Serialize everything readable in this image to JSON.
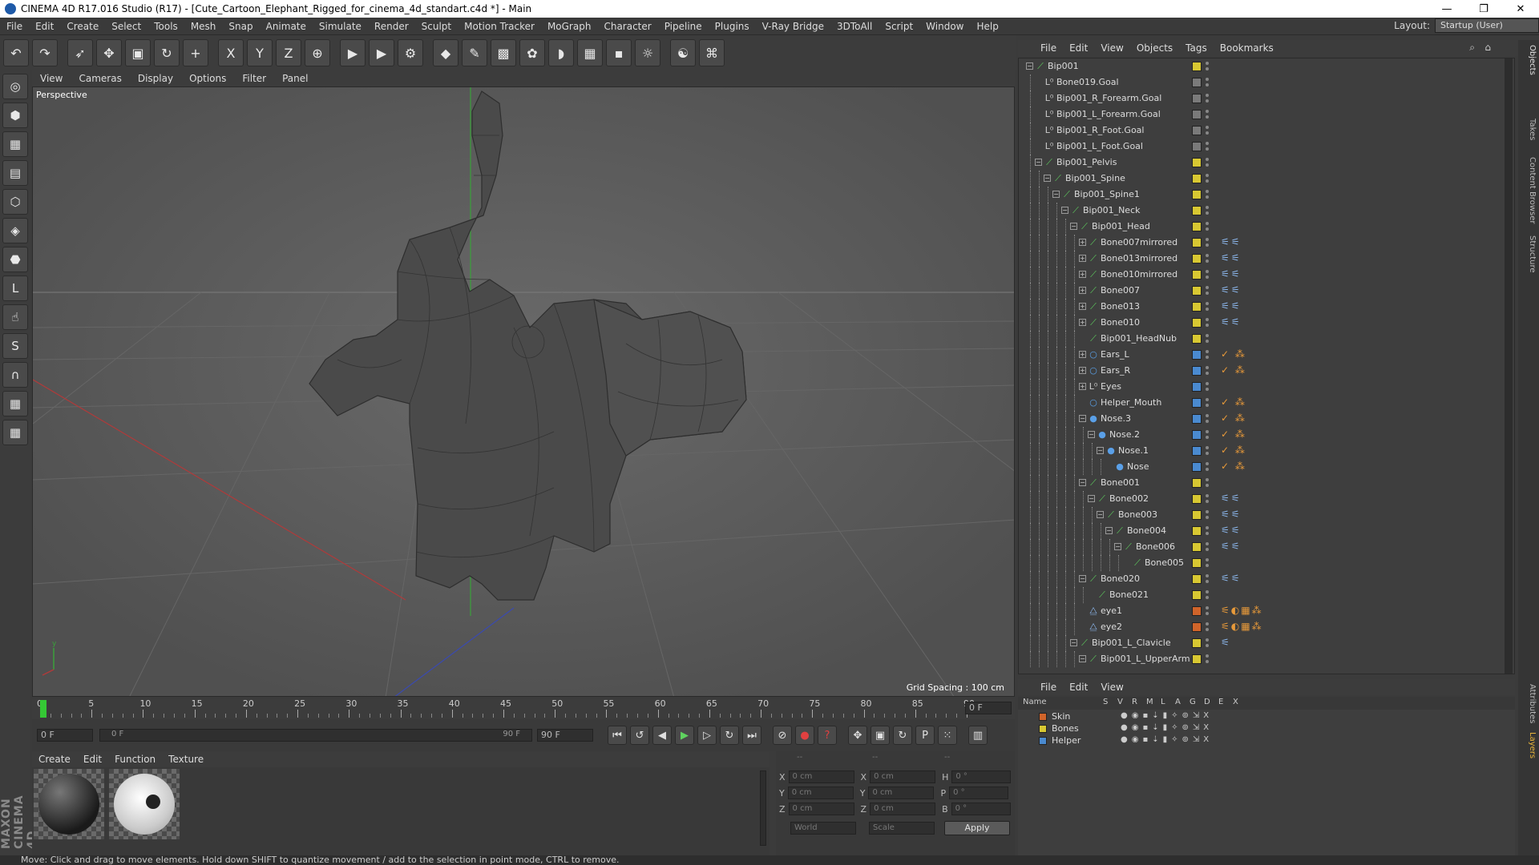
{
  "window": {
    "title": "CINEMA 4D R17.016 Studio (R17) - [Cute_Cartoon_Elephant_Rigged_for_cinema_4d_standart.c4d *] - Main",
    "controls": [
      "—",
      "❐",
      "✕"
    ]
  },
  "menubar": {
    "items": [
      "File",
      "Edit",
      "Create",
      "Select",
      "Tools",
      "Mesh",
      "Snap",
      "Animate",
      "Simulate",
      "Render",
      "Sculpt",
      "Motion Tracker",
      "MoGraph",
      "Character",
      "Pipeline",
      "Plugins",
      "V-Ray Bridge",
      "3DToAll",
      "Script",
      "Window",
      "Help"
    ],
    "layout_label": "Layout:",
    "layout_value": "Startup (User)"
  },
  "toolbar": {
    "icons": [
      "undo-icon",
      "redo-icon",
      "select-icon",
      "move-icon",
      "scale-icon",
      "rotate-icon",
      "add-icon",
      "x-axis-icon",
      "y-axis-icon",
      "z-axis-icon",
      "world-coord-icon",
      "render-view-icon",
      "render-picture-icon",
      "render-settings-icon",
      "cube-icon",
      "pen-icon",
      "subdivision-icon",
      "cloner-icon",
      "deformer-icon",
      "floor-icon",
      "camera-icon",
      "light-icon",
      "script-icon",
      "python-icon"
    ],
    "glyphs": [
      "↶",
      "↷",
      "➶",
      "✥",
      "▣",
      "↻",
      "+",
      "X",
      "Y",
      "Z",
      "⊕",
      "▶",
      "▶",
      "⚙",
      "◆",
      "✎",
      "▩",
      "✿",
      "◗",
      "▦",
      "▪",
      "☼",
      "☯",
      "⌘"
    ]
  },
  "lefttools": {
    "icons": [
      "make-editable-icon",
      "model-mode-icon",
      "texture-mode-icon",
      "workplane-icon",
      "points-mode-icon",
      "edges-mode-icon",
      "polygons-mode-icon",
      "axis-icon",
      "tweak-icon",
      "solo-icon",
      "magnet-icon",
      "snap-icon",
      "lock-icon"
    ],
    "glyphs": [
      "◎",
      "⬢",
      "▦",
      "▤",
      "⬡",
      "◈",
      "⬣",
      "L",
      "☝",
      "S",
      "∩",
      "▦",
      "▦"
    ],
    "logo": "MAXON CINEMA 4D"
  },
  "viewport": {
    "menu": [
      "View",
      "Cameras",
      "Display",
      "Options",
      "Filter",
      "Panel"
    ],
    "camera_label": "Perspective",
    "grid_spacing": "Grid Spacing : 100 cm"
  },
  "timeline": {
    "ticks": [
      "0",
      "5",
      "10",
      "15",
      "20",
      "25",
      "30",
      "35",
      "40",
      "45",
      "50",
      "55",
      "60",
      "65",
      "70",
      "75",
      "80",
      "85",
      "90"
    ],
    "current_frame": "0 F",
    "start_field": "0 F",
    "range_start": "0 F",
    "range_end": "90 F",
    "end_field": "90 F"
  },
  "playback": {
    "glyphs": [
      "⏮",
      "↺",
      "◀",
      "▶",
      "▷",
      "↻",
      "⏭",
      "⊘",
      "●",
      "?",
      "✥",
      "▣",
      "↻",
      "P",
      "⁙",
      "▥"
    ]
  },
  "materials": {
    "menu": [
      "Create",
      "Edit",
      "Function",
      "Texture"
    ],
    "items": [
      {
        "name": "",
        "color": "#3c3c3c"
      },
      {
        "name": "",
        "color": "#eaeaea"
      }
    ]
  },
  "coordinates": {
    "headers": [
      "--",
      "--",
      "--"
    ],
    "rows": [
      {
        "a": "X",
        "v1": "0 cm",
        "b": "X",
        "v2": "0 cm",
        "c": "H",
        "v3": "0 °"
      },
      {
        "a": "Y",
        "v1": "0 cm",
        "b": "Y",
        "v2": "0 cm",
        "c": "P",
        "v3": "0 °"
      },
      {
        "a": "Z",
        "v1": "0 cm",
        "b": "Z",
        "v2": "0 cm",
        "c": "B",
        "v3": "0 °"
      }
    ],
    "mode1": "World",
    "mode2": "Scale",
    "apply": "Apply"
  },
  "status": "Move: Click and drag to move elements. Hold down SHIFT to quantize movement / add to the selection in point mode, CTRL to remove.",
  "objects": {
    "menu": [
      "File",
      "Edit",
      "View",
      "Objects",
      "Tags",
      "Bookmarks"
    ],
    "items": [
      {
        "name": "Bip001",
        "depth": 0,
        "icon": "bone",
        "color": "#d8c832",
        "exp": "−",
        "tags": ""
      },
      {
        "name": "Bone019.Goal",
        "depth": 1,
        "icon": "null",
        "color": "#7a7a7a",
        "exp": "",
        "tags": ""
      },
      {
        "name": "Bip001_R_Forearm.Goal",
        "depth": 1,
        "icon": "null",
        "color": "#7a7a7a",
        "exp": "",
        "tags": ""
      },
      {
        "name": "Bip001_L_Forearm.Goal",
        "depth": 1,
        "icon": "null",
        "color": "#7a7a7a",
        "exp": "",
        "tags": ""
      },
      {
        "name": "Bip001_R_Foot.Goal",
        "depth": 1,
        "icon": "null",
        "color": "#7a7a7a",
        "exp": "",
        "tags": ""
      },
      {
        "name": "Bip001_L_Foot.Goal",
        "depth": 1,
        "icon": "null",
        "color": "#7a7a7a",
        "exp": "",
        "tags": ""
      },
      {
        "name": "Bip001_Pelvis",
        "depth": 1,
        "icon": "bone",
        "color": "#d8c832",
        "exp": "−",
        "tags": ""
      },
      {
        "name": "Bip001_Spine",
        "depth": 2,
        "icon": "bone",
        "color": "#d8c832",
        "exp": "−",
        "tags": ""
      },
      {
        "name": "Bip001_Spine1",
        "depth": 3,
        "icon": "bone",
        "color": "#d8c832",
        "exp": "−",
        "tags": ""
      },
      {
        "name": "Bip001_Neck",
        "depth": 4,
        "icon": "bone",
        "color": "#d8c832",
        "exp": "−",
        "tags": ""
      },
      {
        "name": "Bip001_Head",
        "depth": 5,
        "icon": "bone",
        "color": "#d8c832",
        "exp": "−",
        "tags": ""
      },
      {
        "name": "Bone007mirrored",
        "depth": 6,
        "icon": "bone",
        "color": "#d8c832",
        "exp": "+",
        "tags": "⚟⚟"
      },
      {
        "name": "Bone013mirrored",
        "depth": 6,
        "icon": "bone",
        "color": "#d8c832",
        "exp": "+",
        "tags": "⚟⚟"
      },
      {
        "name": "Bone010mirrored",
        "depth": 6,
        "icon": "bone",
        "color": "#d8c832",
        "exp": "+",
        "tags": "⚟⚟"
      },
      {
        "name": "Bone007",
        "depth": 6,
        "icon": "bone",
        "color": "#d8c832",
        "exp": "+",
        "tags": "⚟⚟"
      },
      {
        "name": "Bone013",
        "depth": 6,
        "icon": "bone",
        "color": "#d8c832",
        "exp": "+",
        "tags": "⚟⚟"
      },
      {
        "name": "Bone010",
        "depth": 6,
        "icon": "bone",
        "color": "#d8c832",
        "exp": "+",
        "tags": "⚟⚟"
      },
      {
        "name": "Bip001_HeadNub",
        "depth": 6,
        "icon": "bone",
        "color": "#d8c832",
        "exp": "",
        "tags": ""
      },
      {
        "name": "Ears_L",
        "depth": 6,
        "icon": "mesh",
        "color": "#4a8ad0",
        "exp": "+",
        "tags": "✓ ⁂"
      },
      {
        "name": "Ears_R",
        "depth": 6,
        "icon": "mesh",
        "color": "#4a8ad0",
        "exp": "+",
        "tags": "✓ ⁂"
      },
      {
        "name": "Eyes",
        "depth": 6,
        "icon": "null",
        "color": "#4a8ad0",
        "exp": "+",
        "tags": ""
      },
      {
        "name": "Helper_Mouth",
        "depth": 6,
        "icon": "mesh",
        "color": "#4a8ad0",
        "exp": "",
        "tags": "✓ ⁂"
      },
      {
        "name": "Nose.3",
        "depth": 6,
        "icon": "sphere",
        "color": "#4a8ad0",
        "exp": "−",
        "tags": "✓ ⁂"
      },
      {
        "name": "Nose.2",
        "depth": 7,
        "icon": "sphere",
        "color": "#4a8ad0",
        "exp": "−",
        "tags": "✓ ⁂"
      },
      {
        "name": "Nose.1",
        "depth": 8,
        "icon": "sphere",
        "color": "#4a8ad0",
        "exp": "−",
        "tags": "✓ ⁂"
      },
      {
        "name": "Nose",
        "depth": 9,
        "icon": "sphere",
        "color": "#4a8ad0",
        "exp": "",
        "tags": "✓ ⁂"
      },
      {
        "name": "Bone001",
        "depth": 6,
        "icon": "bone",
        "color": "#d8c832",
        "exp": "−",
        "tags": ""
      },
      {
        "name": "Bone002",
        "depth": 7,
        "icon": "bone",
        "color": "#d8c832",
        "exp": "−",
        "tags": "⚟⚟"
      },
      {
        "name": "Bone003",
        "depth": 8,
        "icon": "bone",
        "color": "#d8c832",
        "exp": "−",
        "tags": "⚟⚟"
      },
      {
        "name": "Bone004",
        "depth": 9,
        "icon": "bone",
        "color": "#d8c832",
        "exp": "−",
        "tags": "⚟⚟"
      },
      {
        "name": "Bone006",
        "depth": 10,
        "icon": "bone",
        "color": "#d8c832",
        "exp": "−",
        "tags": "⚟⚟"
      },
      {
        "name": "Bone005",
        "depth": 11,
        "icon": "bone",
        "color": "#d8c832",
        "exp": "",
        "tags": ""
      },
      {
        "name": "Bone020",
        "depth": 6,
        "icon": "bone",
        "color": "#d8c832",
        "exp": "−",
        "tags": "⚟⚟"
      },
      {
        "name": "Bone021",
        "depth": 7,
        "icon": "bone",
        "color": "#d8c832",
        "exp": "",
        "tags": ""
      },
      {
        "name": "eye1",
        "depth": 6,
        "icon": "joint",
        "color": "#d0642a",
        "exp": "",
        "tags": "⚟◐▦⁂"
      },
      {
        "name": "eye2",
        "depth": 6,
        "icon": "joint",
        "color": "#d0642a",
        "exp": "",
        "tags": "⚟◐▦⁂"
      },
      {
        "name": "Bip001_L_Clavicle",
        "depth": 5,
        "icon": "bone",
        "color": "#d8c832",
        "exp": "−",
        "tags": "⚟"
      },
      {
        "name": "Bip001_L_UpperArm",
        "depth": 6,
        "icon": "bone",
        "color": "#d8c832",
        "exp": "−",
        "tags": ""
      }
    ]
  },
  "layers": {
    "menu": [
      "File",
      "Edit",
      "View"
    ],
    "headers": [
      "Name",
      "S",
      "V",
      "R",
      "M",
      "L",
      "A",
      "G",
      "D",
      "E",
      "X"
    ],
    "items": [
      {
        "name": "Skin",
        "color": "#d0642a"
      },
      {
        "name": "Bones",
        "color": "#d8c832"
      },
      {
        "name": "Helper",
        "color": "#4a8ad0"
      }
    ],
    "flags": "●◉▪⇣▮✧⊚⇲X"
  },
  "sidetabs": [
    "Objects",
    "Takes",
    "Content Browser",
    "Structure",
    "Attributes",
    "Layers"
  ]
}
